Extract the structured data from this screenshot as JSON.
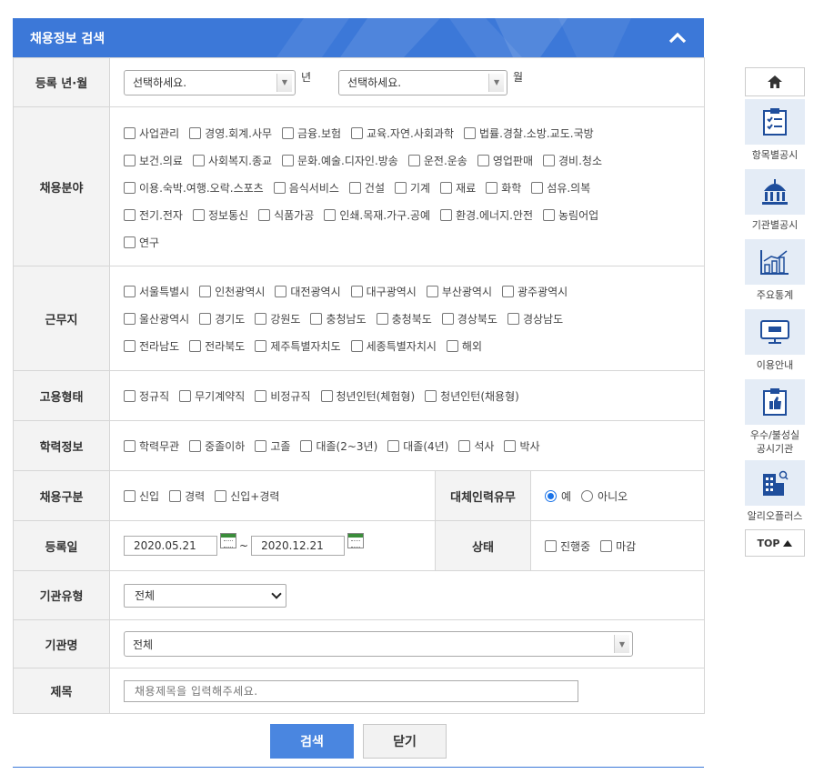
{
  "header": {
    "title": "채용정보 검색"
  },
  "year_month": {
    "label": "등록 년·월",
    "year_value": "선택하세요.",
    "year_unit": "년",
    "month_value": "선택하세요.",
    "month_unit": "월"
  },
  "field": {
    "label": "채용분야",
    "rows": [
      [
        "사업관리",
        "경영.회계.사무",
        "금융.보험",
        "교육.자연.사회과학",
        "법률.경찰.소방.교도.국방"
      ],
      [
        "보건.의료",
        "사회복지.종교",
        "문화.예술.디자인.방송",
        "운전.운송",
        "영업판매",
        "경비.청소"
      ],
      [
        "이용.숙박.여행.오락.스포츠",
        "음식서비스",
        "건설",
        "기계",
        "재료",
        "화학",
        "섬유.의복"
      ],
      [
        "전기.전자",
        "정보통신",
        "식품가공",
        "인쇄.목재.가구.공예",
        "환경.에너지.안전",
        "농림어업"
      ],
      [
        "연구"
      ]
    ]
  },
  "region": {
    "label": "근무지",
    "rows": [
      [
        "서울특별시",
        "인천광역시",
        "대전광역시",
        "대구광역시",
        "부산광역시",
        "광주광역시"
      ],
      [
        "울산광역시",
        "경기도",
        "강원도",
        "충청남도",
        "충청북도",
        "경상북도",
        "경상남도"
      ],
      [
        "전라남도",
        "전라북도",
        "제주특별자치도",
        "세종특별자치시",
        "해외"
      ]
    ]
  },
  "employment": {
    "label": "고용형태",
    "options": [
      "정규직",
      "무기계약직",
      "비정규직",
      "청년인턴(체험형)",
      "청년인턴(채용형)"
    ]
  },
  "education": {
    "label": "학력정보",
    "options": [
      "학력무관",
      "중졸이하",
      "고졸",
      "대졸(2~3년)",
      "대졸(4년)",
      "석사",
      "박사"
    ]
  },
  "hire_type": {
    "label": "채용구분",
    "options": [
      "신입",
      "경력",
      "신입+경력"
    ]
  },
  "replacement": {
    "label": "대체인력유무",
    "yes": "예",
    "no": "아니오",
    "selected": "예"
  },
  "reg_date": {
    "label": "등록일",
    "from": "2020.05.21",
    "to": "2020.12.21",
    "sep": "~"
  },
  "status": {
    "label": "상태",
    "options": [
      "진행중",
      "마감"
    ]
  },
  "org_type": {
    "label": "기관유형",
    "value": "전체"
  },
  "org_name": {
    "label": "기관명",
    "value": "전체"
  },
  "title_field": {
    "label": "제목",
    "placeholder": "채용제목을 입력해주세요."
  },
  "buttons": {
    "search": "검색",
    "close": "닫기"
  },
  "quick_menu": {
    "items": [
      "항목별공시",
      "기관별공시",
      "주요통계",
      "이용안내",
      "우수/불성실 공시기관",
      "알리오플러스"
    ],
    "top": "TOP"
  },
  "colors": {
    "header": "#3c78d8",
    "button": "#4a86e0",
    "quick_icon_bg": "#e4ecf6"
  }
}
